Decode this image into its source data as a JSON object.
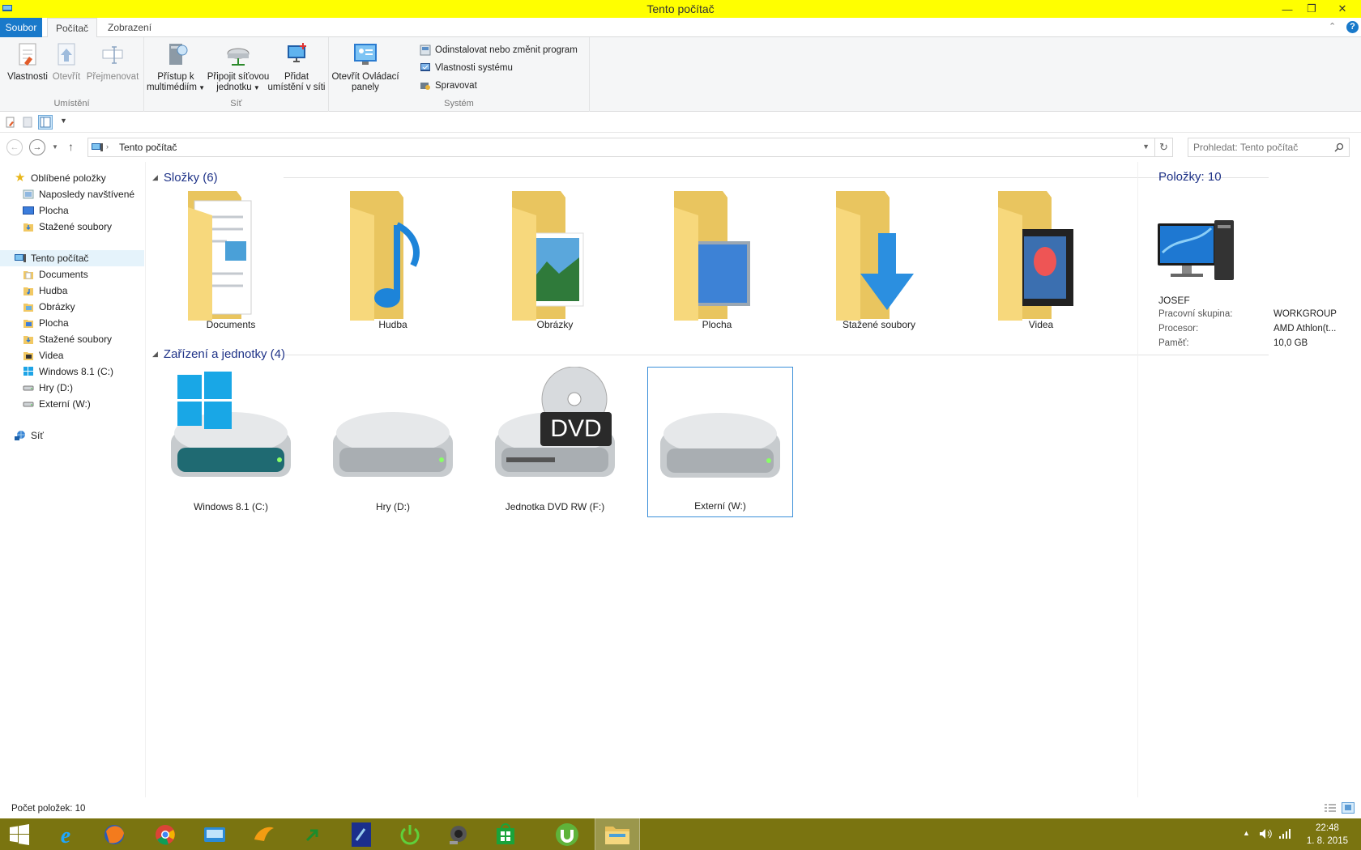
{
  "window": {
    "title": "Tento počítač",
    "minimize": "—",
    "restore": "❐",
    "close": "✕"
  },
  "tabs": {
    "file": "Soubor",
    "computer": "Počítač",
    "view": "Zobrazení"
  },
  "ribbon": {
    "groups": {
      "location": "Umístění",
      "network": "Síť",
      "system": "Systém"
    },
    "properties": "Vlastnosti",
    "open": "Otevřít",
    "rename": "Přejmenovat",
    "media_access_1": "Přístup k",
    "media_access_2": "multimédiím",
    "map_drive_1": "Připojit síťovou",
    "map_drive_2": "jednotku",
    "add_location_1": "Přidat",
    "add_location_2": "umístění v síti",
    "control_panel_1": "Otevřít Ovládací",
    "control_panel_2": "panely",
    "uninstall": "Odinstalovat nebo změnit program",
    "sys_props": "Vlastnosti systému",
    "manage": "Spravovat"
  },
  "address": {
    "path": "Tento počítač",
    "search_placeholder": "Prohledat: Tento počítač"
  },
  "nav": {
    "favorites": "Oblíbené položky",
    "fav_items": [
      "Naposledy navštívené",
      "Plocha",
      "Stažené soubory"
    ],
    "this_pc": "Tento počítač",
    "pc_items": [
      "Documents",
      "Hudba",
      "Obrázky",
      "Plocha",
      "Stažené soubory",
      "Videa",
      "Windows 8.1 (C:)",
      "Hry (D:)",
      "Externí (W:)"
    ],
    "network": "Síť"
  },
  "content": {
    "folders_header": "Složky (6)",
    "folders": [
      "Documents",
      "Hudba",
      "Obrázky",
      "Plocha",
      "Stažené soubory",
      "Videa"
    ],
    "devices_header": "Zařízení a jednotky (4)",
    "devices": [
      "Windows 8.1 (C:)",
      "Hry (D:)",
      "Jednotka DVD RW (F:)",
      "Externí (W:)"
    ],
    "dvd_label": "DVD"
  },
  "details": {
    "items": "Položky: 10",
    "name": "JOSEF",
    "workgroup_label": "Pracovní skupina:",
    "workgroup_value": "WORKGROUP",
    "cpu_label": "Procesor:",
    "cpu_value": "AMD Athlon(t...",
    "memory_label": "Paměť:",
    "memory_value": "10,0 GB"
  },
  "status": {
    "count": "Počet položek: 10"
  },
  "clock": {
    "time": "22:48",
    "date": "1. 8. 2015"
  },
  "colors": {
    "title_bar": "#ffff00",
    "taskbar": "#7a7410",
    "file_tab": "#1979ca",
    "group_header": "#1e3287",
    "folder": "#f7d87c"
  }
}
